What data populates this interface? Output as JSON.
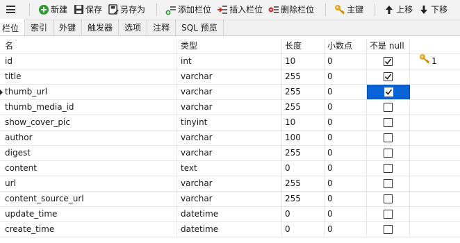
{
  "toolbar": {
    "new_label": "新建",
    "save_label": "保存",
    "save_as_label": "另存为",
    "add_field_label": "添加栏位",
    "insert_field_label": "插入栏位",
    "delete_field_label": "删除栏位",
    "primary_key_label": "主键",
    "move_up_label": "上移",
    "move_down_label": "下移"
  },
  "tabs": [
    {
      "label": "栏位",
      "active": true
    },
    {
      "label": "索引"
    },
    {
      "label": "外键"
    },
    {
      "label": "触发器"
    },
    {
      "label": "选项"
    },
    {
      "label": "注释"
    },
    {
      "label": "SQL 预览"
    }
  ],
  "columns": {
    "name": "名",
    "type": "类型",
    "length": "长度",
    "decimals": "小数点",
    "not_null": "不是 null",
    "key": ""
  },
  "fields": [
    {
      "name": "id",
      "type": "int",
      "length": "10",
      "decimals": "0",
      "not_null": true,
      "key": "1"
    },
    {
      "name": "title",
      "type": "varchar",
      "length": "255",
      "decimals": "0",
      "not_null": true,
      "key": ""
    },
    {
      "name": "thumb_url",
      "type": "varchar",
      "length": "255",
      "decimals": "0",
      "not_null": true,
      "key": ""
    },
    {
      "name": "thumb_media_id",
      "type": "varchar",
      "length": "255",
      "decimals": "0",
      "not_null": false,
      "key": ""
    },
    {
      "name": "show_cover_pic",
      "type": "tinyint",
      "length": "10",
      "decimals": "0",
      "not_null": false,
      "key": ""
    },
    {
      "name": "author",
      "type": "varchar",
      "length": "100",
      "decimals": "0",
      "not_null": false,
      "key": ""
    },
    {
      "name": "digest",
      "type": "varchar",
      "length": "255",
      "decimals": "0",
      "not_null": false,
      "key": ""
    },
    {
      "name": "content",
      "type": "text",
      "length": "0",
      "decimals": "0",
      "not_null": false,
      "key": ""
    },
    {
      "name": "url",
      "type": "varchar",
      "length": "255",
      "decimals": "0",
      "not_null": false,
      "key": ""
    },
    {
      "name": "content_source_url",
      "type": "varchar",
      "length": "255",
      "decimals": "0",
      "not_null": false,
      "key": ""
    },
    {
      "name": "update_time",
      "type": "datetime",
      "length": "0",
      "decimals": "0",
      "not_null": false,
      "key": ""
    },
    {
      "name": "create_time",
      "type": "datetime",
      "length": "0",
      "decimals": "0",
      "not_null": false,
      "key": ""
    }
  ],
  "current_row": 2,
  "colors": {
    "selection": "#0a64d8",
    "new_icon": "#2e9b2e",
    "delete_icon": "#d03030",
    "key_icon": "#e6a817"
  }
}
